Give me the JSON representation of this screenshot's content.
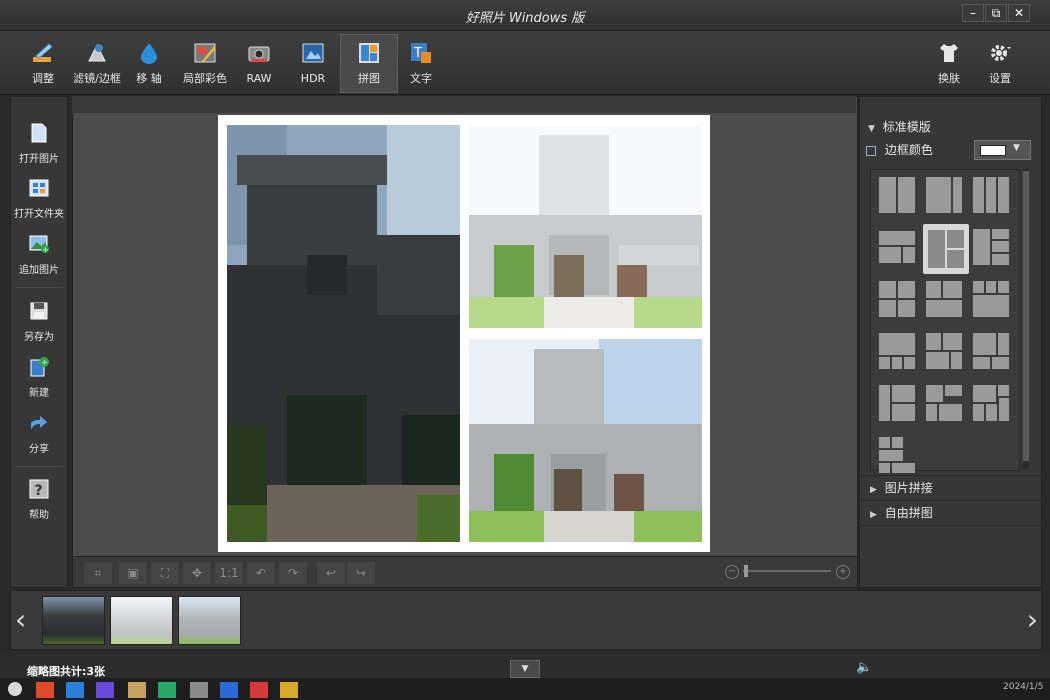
{
  "window": {
    "title": "好照片 Windows 版",
    "controls": [
      "–",
      "⧉",
      "✕"
    ]
  },
  "toolbar": {
    "tools": [
      {
        "label": "调整",
        "icon": "adjust-brush-icon"
      },
      {
        "label": "滤镜/边框",
        "icon": "filter-frame-icon"
      },
      {
        "label": "移 轴",
        "icon": "tilt-shift-drop-icon"
      },
      {
        "label": "局部彩色",
        "icon": "partial-color-icon"
      },
      {
        "label": "RAW",
        "icon": "raw-camera-icon"
      },
      {
        "label": "HDR",
        "icon": "hdr-film-icon"
      },
      {
        "label": "拼图",
        "icon": "collage-icon",
        "active": true
      },
      {
        "label": "文字",
        "icon": "text-icon"
      }
    ],
    "right": [
      {
        "label": "换肤",
        "icon": "shirt-icon"
      },
      {
        "label": "设置",
        "icon": "gear-icon"
      }
    ]
  },
  "left_panel": {
    "items": [
      {
        "label": "打开图片",
        "icon": "open-file-icon"
      },
      {
        "label": "打开文件夹",
        "icon": "open-folder-icon"
      },
      {
        "label": "追加图片",
        "icon": "add-image-icon"
      },
      {
        "label": "另存为",
        "icon": "save-as-icon"
      },
      {
        "label": "新建",
        "icon": "new-icon"
      },
      {
        "label": "分享",
        "icon": "share-icon"
      },
      {
        "label": "帮助",
        "icon": "help-icon"
      }
    ]
  },
  "canvas_toolbar": {
    "buttons": [
      "crop",
      "fit",
      "fullscreen",
      "center",
      "1:1",
      "rotate-left",
      "rotate-right",
      "undo",
      "redo"
    ],
    "one_to_one_label": "1:1"
  },
  "right_panel": {
    "standard_templates": "标准模版",
    "border_color": "边框颜色",
    "picture_stitch": "图片拼接",
    "free_collage": "自由拼图"
  },
  "thumbnails": {
    "count_label": "缩略图共计:3张",
    "count": 3
  },
  "taskbar": {
    "date": "2024/1/5"
  },
  "colors": {
    "accent": "#4aa3df",
    "panel": "#373737",
    "canvas": "#4c4c4c"
  }
}
